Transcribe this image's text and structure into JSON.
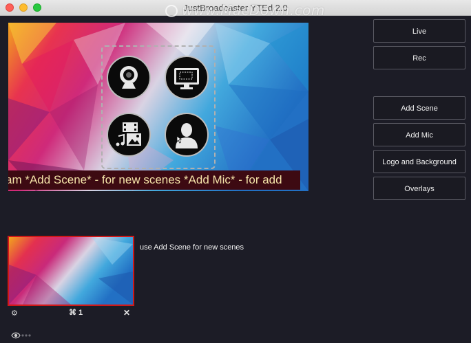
{
  "window": {
    "title": "JustBroadcaster YTEd 2.0"
  },
  "watermark": {
    "text": "www.MacDown.com"
  },
  "preview": {
    "ticker_text": "am  *Add Scene* - for new scenes  *Add Mic* - for add"
  },
  "source_buttons": [
    "webcam-icon",
    "screen-capture-icon",
    "media-files-icon",
    "user-silhouette-icon"
  ],
  "sidebar": {
    "live": "Live",
    "rec": "Rec",
    "add_scene": "Add Scene",
    "add_mic": "Add Mic",
    "logo_background": "Logo and Background",
    "overlays": "Overlays"
  },
  "scenes": {
    "hint": "use Add Scene for new scenes",
    "items": [
      {
        "shortcut": "⌘ 1",
        "settings_icon": "gear-icon",
        "close_icon": "close-icon",
        "selected_color": "#d01818"
      }
    ]
  },
  "footer": {
    "icon": "eye-icon"
  },
  "colors": {
    "background": "#1c1c26",
    "accent_red": "#d01818",
    "ticker_bg": "#3d0a12",
    "ticker_text": "#f4e3a8"
  }
}
